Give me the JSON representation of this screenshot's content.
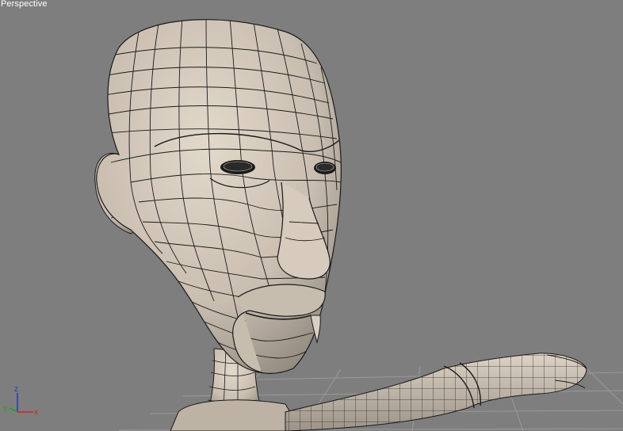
{
  "viewport": {
    "label": "Perspective",
    "background": "#7e7e7e"
  },
  "axis_gizmo": {
    "x_label": "x",
    "y_label": "y",
    "z_label": "z",
    "x_color": "#d02020",
    "y_color": "#20a020",
    "z_color": "#2040c0"
  },
  "model": {
    "name": "character-head-wireframe-mesh",
    "surface_color": "#cdc3b5",
    "wire_color": "#1a1a1a"
  }
}
